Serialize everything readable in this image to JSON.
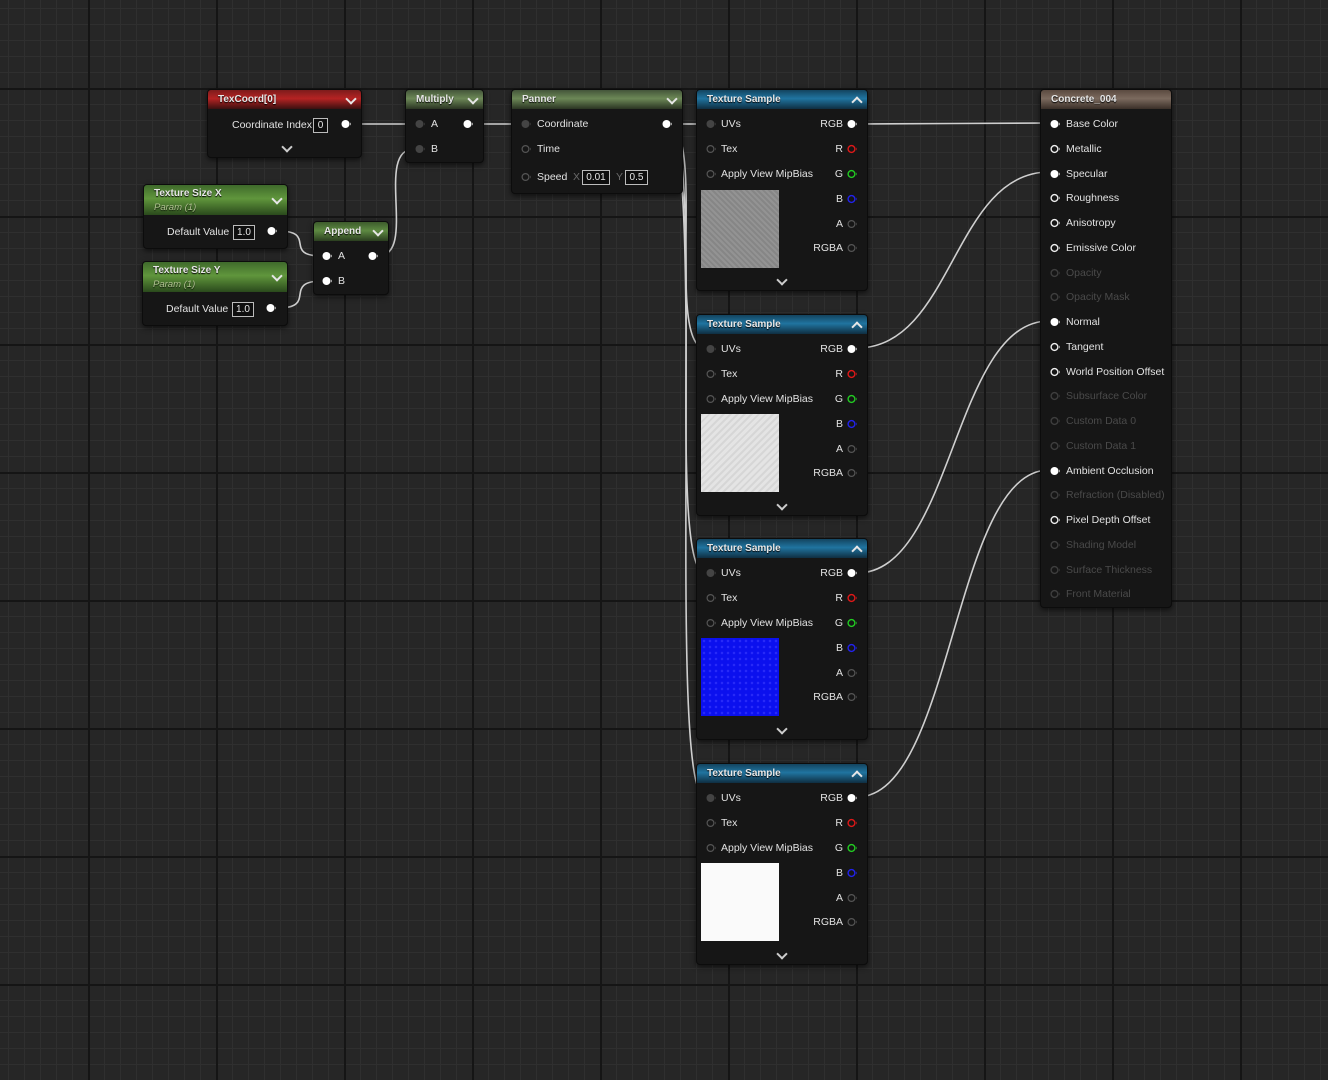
{
  "colors": {
    "wire": "#cfcfcf",
    "pin_white": "#ffffff",
    "pin_red": "#e01818",
    "pin_green": "#22cc22",
    "pin_blue": "#2222ee",
    "pin_disabled": "#555555"
  },
  "texcoord": {
    "title": "TexCoord[0]",
    "coordinate_index_label": "Coordinate Index",
    "coordinate_index_value": "0"
  },
  "multiply": {
    "title": "Multiply",
    "pin_a": "A",
    "pin_b": "B"
  },
  "panner": {
    "title": "Panner",
    "coordinate_label": "Coordinate",
    "time_label": "Time",
    "speed_label": "Speed",
    "x_label": "X",
    "x_value": "0.01",
    "y_label": "Y",
    "y_value": "0.5"
  },
  "texture_size_x": {
    "title": "Texture Size X",
    "subtitle": "Param (1)",
    "default_value_label": "Default Value",
    "default_value": "1.0"
  },
  "texture_size_y": {
    "title": "Texture Size Y",
    "subtitle": "Param (1)",
    "default_value_label": "Default Value",
    "default_value": "1.0"
  },
  "append": {
    "title": "Append",
    "pin_a": "A",
    "pin_b": "B"
  },
  "texture_samples": [
    {
      "title": "Texture Sample",
      "preview": "gray-concrete-texture",
      "inputs": [
        "UVs",
        "Tex",
        "Apply View MipBias"
      ],
      "outputs": [
        "RGB",
        "R",
        "G",
        "B",
        "A",
        "RGBA"
      ]
    },
    {
      "title": "Texture Sample",
      "preview": "light-gray-texture",
      "inputs": [
        "UVs",
        "Tex",
        "Apply View MipBias"
      ],
      "outputs": [
        "RGB",
        "R",
        "G",
        "B",
        "A",
        "RGBA"
      ]
    },
    {
      "title": "Texture Sample",
      "preview": "blue-normal-map-texture",
      "inputs": [
        "UVs",
        "Tex",
        "Apply View MipBias"
      ],
      "outputs": [
        "RGB",
        "R",
        "G",
        "B",
        "A",
        "RGBA"
      ]
    },
    {
      "title": "Texture Sample",
      "preview": "white-texture",
      "inputs": [
        "UVs",
        "Tex",
        "Apply View MipBias"
      ],
      "outputs": [
        "RGB",
        "R",
        "G",
        "B",
        "A",
        "RGBA"
      ]
    }
  ],
  "material": {
    "title": "Concrete_004",
    "inputs": [
      {
        "label": "Base Color",
        "enabled": true,
        "connected": true
      },
      {
        "label": "Metallic",
        "enabled": true,
        "connected": false
      },
      {
        "label": "Specular",
        "enabled": true,
        "connected": true
      },
      {
        "label": "Roughness",
        "enabled": true,
        "connected": false
      },
      {
        "label": "Anisotropy",
        "enabled": true,
        "connected": false
      },
      {
        "label": "Emissive Color",
        "enabled": true,
        "connected": false
      },
      {
        "label": "Opacity",
        "enabled": false,
        "connected": false
      },
      {
        "label": "Opacity Mask",
        "enabled": false,
        "connected": false
      },
      {
        "label": "Normal",
        "enabled": true,
        "connected": true
      },
      {
        "label": "Tangent",
        "enabled": true,
        "connected": false
      },
      {
        "label": "World Position Offset",
        "enabled": true,
        "connected": false
      },
      {
        "label": "Subsurface Color",
        "enabled": false,
        "connected": false
      },
      {
        "label": "Custom Data 0",
        "enabled": false,
        "connected": false
      },
      {
        "label": "Custom Data 1",
        "enabled": false,
        "connected": false
      },
      {
        "label": "Ambient Occlusion",
        "enabled": true,
        "connected": true
      },
      {
        "label": "Refraction (Disabled)",
        "enabled": false,
        "connected": false
      },
      {
        "label": "Pixel Depth Offset",
        "enabled": true,
        "connected": false
      },
      {
        "label": "Shading Model",
        "enabled": false,
        "connected": false
      },
      {
        "label": "Surface Thickness",
        "enabled": false,
        "connected": false
      },
      {
        "label": "Front Material",
        "enabled": false,
        "connected": false
      }
    ]
  }
}
